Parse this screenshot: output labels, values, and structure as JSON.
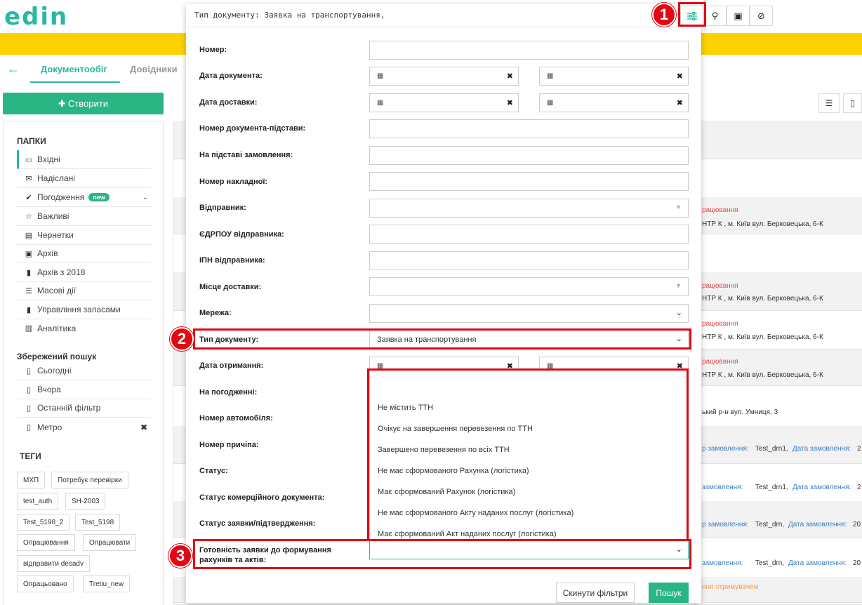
{
  "app": {
    "logo": "edin"
  },
  "nav": {
    "back_icon": "arrow-left-icon",
    "tabs": [
      "Документообіг",
      "Довідники"
    ]
  },
  "create_button": {
    "label": "Створити",
    "icon": "plus-icon"
  },
  "sidebar": {
    "folders_title": "ПАПКИ",
    "folders": [
      {
        "label": "Вхідні",
        "icon": "inbox-icon"
      },
      {
        "label": "Надіслані",
        "icon": "envelope-icon"
      },
      {
        "label": "Погодження",
        "icon": "check-icon",
        "badge": "new"
      },
      {
        "label": "Важливі",
        "icon": "star-icon"
      },
      {
        "label": "Чернетки",
        "icon": "draft-icon"
      },
      {
        "label": "Архів",
        "icon": "archive-icon"
      },
      {
        "label": "Архів з 2018",
        "icon": "file-icon"
      },
      {
        "label": "Масові дії",
        "icon": "stack-icon"
      },
      {
        "label": "Управління запасами",
        "icon": "file-icon"
      },
      {
        "label": "Аналітика",
        "icon": "bar-chart-icon"
      }
    ],
    "saved_title": "Збережений пошук",
    "saved": [
      {
        "label": "Сьогодні"
      },
      {
        "label": "Вчора"
      },
      {
        "label": "Останній фільтр"
      },
      {
        "label": "Метро"
      }
    ],
    "tags_title": "ТЕГИ",
    "tags": [
      "МХП",
      "Потребує перевірки",
      "test_auth",
      "SH-2003",
      "Test_5198_2",
      "Test_5198",
      "Опрацювання",
      "Опрацювати",
      "відправити desadv",
      "Опрацьовано",
      "Tretiu_new"
    ]
  },
  "background_rows": {
    "status_processing": "рацювання",
    "address_1": "НТР К , м. Київ вул. Берковецька, 6-К",
    "address_2": "ький р-н вул. Умниця, 3",
    "order_label": "р замовлення:",
    "order_label2": "замовлення:",
    "order_label3": "р замовлення:",
    "order_val_1": "Test_drn1,",
    "order_val_2": "Test_drn,",
    "date_label": "Дата замовлення:",
    "date_val_1": "2",
    "date_val_2": "20",
    "status_received": "ння отримувачем"
  },
  "panel": {
    "query": "Тип документу: Заявка на транспортування,",
    "toolbar_icons": [
      "sliders-icon",
      "search-icon",
      "save-icon",
      "ban-icon"
    ],
    "fields": [
      {
        "label": "Номер:"
      },
      {
        "label": "Дата документа:"
      },
      {
        "label": "Дата доставки:"
      },
      {
        "label": "Номер документа-підстави:"
      },
      {
        "label": "На підставі замовлення:"
      },
      {
        "label": "Номер накладної:"
      },
      {
        "label": "Відправник:"
      },
      {
        "label": "ЄДРПОУ відправника:"
      },
      {
        "label": "ІПН відправника:"
      },
      {
        "label": "Місце доставки:"
      },
      {
        "label": "Мережа:"
      },
      {
        "label": "Тип документу:",
        "value": "Заявка на транспортування"
      },
      {
        "label": "Дата отримання:"
      },
      {
        "label": "На погодженні:"
      },
      {
        "label": "Номер автомобіля:"
      },
      {
        "label": "Номер причіпа:"
      },
      {
        "label": "Статус:"
      },
      {
        "label": "Статус комерційного документа:"
      },
      {
        "label": "Статус заявки/підтвердження:"
      },
      {
        "label": "Готовність заявки до формування рахунків та актів:"
      }
    ],
    "readiness_options": [
      "Не містить ТТН",
      "Очікує на завершення перевезення по ТТН",
      "Завершено перевезення по всіх ТТН",
      "Не має сформованого Рахунка (логістика)",
      "Має сформований Рахунок (логістика)",
      "Не має сформованого Акту наданих послуг (логістика)",
      "Має сформований Акт наданих послуг (логістика)"
    ],
    "reset_button": "Скинути фільтри",
    "search_button": "Пошук"
  },
  "callouts": [
    "1",
    "2",
    "3"
  ],
  "colors": {
    "accent": "#2ab8a3",
    "primary_green": "#2ab585",
    "yellow": "#fed100",
    "highlight_red": "#e30613"
  }
}
